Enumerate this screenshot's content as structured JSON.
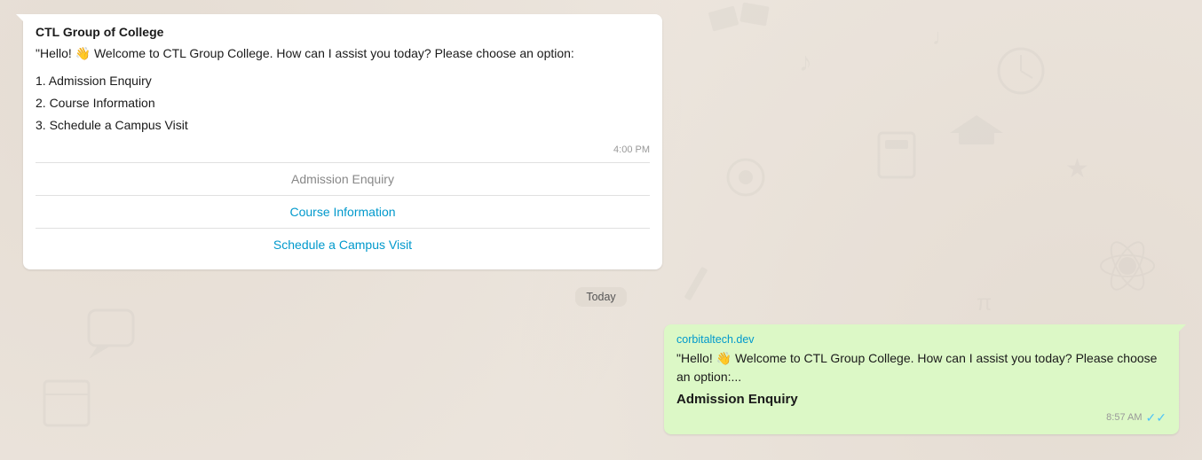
{
  "background": {
    "color": "#ece5dd"
  },
  "leftBubble": {
    "senderName": "CTL Group of College",
    "messageIntro": "\"Hello! 👋 Welcome to CTL  Group College. How can I assist you today? Please choose an option:",
    "options": [
      "1. Admission Enquiry",
      "2. Course Information",
      "3. Schedule a Campus Visit"
    ],
    "timestamp": "4:00 PM",
    "quickReplies": [
      {
        "label": "Admission Enquiry",
        "selected": false
      },
      {
        "label": "Course Information",
        "selected": true
      },
      {
        "label": "Schedule a Campus Visit",
        "selected": false
      }
    ]
  },
  "dateDivider": {
    "label": "Today"
  },
  "rightBubble": {
    "link": "corbitaltech.dev",
    "messageIntro": "\"Hello! 👋 Welcome to CTL  Group College. How can I assist you today? Please choose an option:...",
    "selection": "Admission Enquiry",
    "timestamp": "8:57 AM",
    "readStatus": "✓✓"
  }
}
